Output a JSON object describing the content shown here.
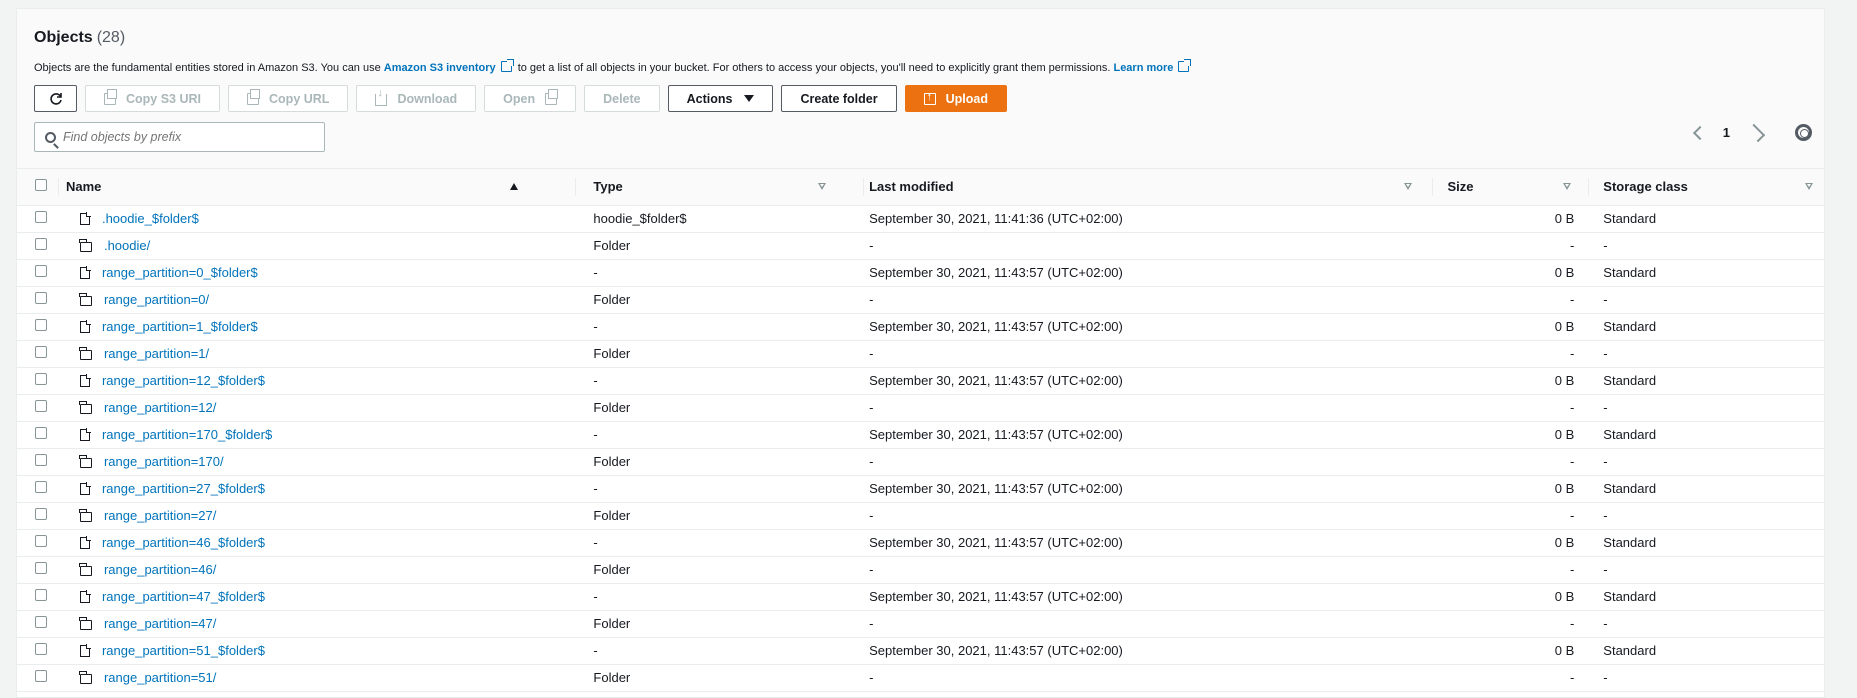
{
  "header": {
    "title": "Objects",
    "count": "(28)",
    "desc_pre": "Objects are the fundamental entities stored in Amazon S3. You can use ",
    "desc_link1": "Amazon S3 inventory",
    "desc_mid": " to get a list of all objects in your bucket. For others to access your objects, you'll need to explicitly grant them permissions. ",
    "desc_link2": "Learn more"
  },
  "toolbar": {
    "copy_s3_uri": "Copy S3 URI",
    "copy_url": "Copy URL",
    "download": "Download",
    "open": "Open",
    "delete": "Delete",
    "actions": "Actions",
    "create_folder": "Create folder",
    "upload": "Upload"
  },
  "search": {
    "placeholder": "Find objects by prefix"
  },
  "pager": {
    "page": "1"
  },
  "columns": {
    "name": "Name",
    "type": "Type",
    "last_modified": "Last modified",
    "size": "Size",
    "storage_class": "Storage class"
  },
  "rows": [
    {
      "name": ".hoodie_$folder$",
      "kind": "file",
      "type": "hoodie_$folder$",
      "modified": "September 30, 2021, 11:41:36 (UTC+02:00)",
      "size": "0 B",
      "storage": "Standard"
    },
    {
      "name": ".hoodie/",
      "kind": "folder",
      "type": "Folder",
      "modified": "-",
      "size": "-",
      "storage": "-"
    },
    {
      "name": "range_partition=0_$folder$",
      "kind": "file",
      "type": "-",
      "modified": "September 30, 2021, 11:43:57 (UTC+02:00)",
      "size": "0 B",
      "storage": "Standard"
    },
    {
      "name": "range_partition=0/",
      "kind": "folder",
      "type": "Folder",
      "modified": "-",
      "size": "-",
      "storage": "-"
    },
    {
      "name": "range_partition=1_$folder$",
      "kind": "file",
      "type": "-",
      "modified": "September 30, 2021, 11:43:57 (UTC+02:00)",
      "size": "0 B",
      "storage": "Standard"
    },
    {
      "name": "range_partition=1/",
      "kind": "folder",
      "type": "Folder",
      "modified": "-",
      "size": "-",
      "storage": "-"
    },
    {
      "name": "range_partition=12_$folder$",
      "kind": "file",
      "type": "-",
      "modified": "September 30, 2021, 11:43:57 (UTC+02:00)",
      "size": "0 B",
      "storage": "Standard"
    },
    {
      "name": "range_partition=12/",
      "kind": "folder",
      "type": "Folder",
      "modified": "-",
      "size": "-",
      "storage": "-"
    },
    {
      "name": "range_partition=170_$folder$",
      "kind": "file",
      "type": "-",
      "modified": "September 30, 2021, 11:43:57 (UTC+02:00)",
      "size": "0 B",
      "storage": "Standard"
    },
    {
      "name": "range_partition=170/",
      "kind": "folder",
      "type": "Folder",
      "modified": "-",
      "size": "-",
      "storage": "-"
    },
    {
      "name": "range_partition=27_$folder$",
      "kind": "file",
      "type": "-",
      "modified": "September 30, 2021, 11:43:57 (UTC+02:00)",
      "size": "0 B",
      "storage": "Standard"
    },
    {
      "name": "range_partition=27/",
      "kind": "folder",
      "type": "Folder",
      "modified": "-",
      "size": "-",
      "storage": "-"
    },
    {
      "name": "range_partition=46_$folder$",
      "kind": "file",
      "type": "-",
      "modified": "September 30, 2021, 11:43:57 (UTC+02:00)",
      "size": "0 B",
      "storage": "Standard"
    },
    {
      "name": "range_partition=46/",
      "kind": "folder",
      "type": "Folder",
      "modified": "-",
      "size": "-",
      "storage": "-"
    },
    {
      "name": "range_partition=47_$folder$",
      "kind": "file",
      "type": "-",
      "modified": "September 30, 2021, 11:43:57 (UTC+02:00)",
      "size": "0 B",
      "storage": "Standard"
    },
    {
      "name": "range_partition=47/",
      "kind": "folder",
      "type": "Folder",
      "modified": "-",
      "size": "-",
      "storage": "-"
    },
    {
      "name": "range_partition=51_$folder$",
      "kind": "file",
      "type": "-",
      "modified": "September 30, 2021, 11:43:57 (UTC+02:00)",
      "size": "0 B",
      "storage": "Standard"
    },
    {
      "name": "range_partition=51/",
      "kind": "folder",
      "type": "Folder",
      "modified": "-",
      "size": "-",
      "storage": "-"
    }
  ]
}
